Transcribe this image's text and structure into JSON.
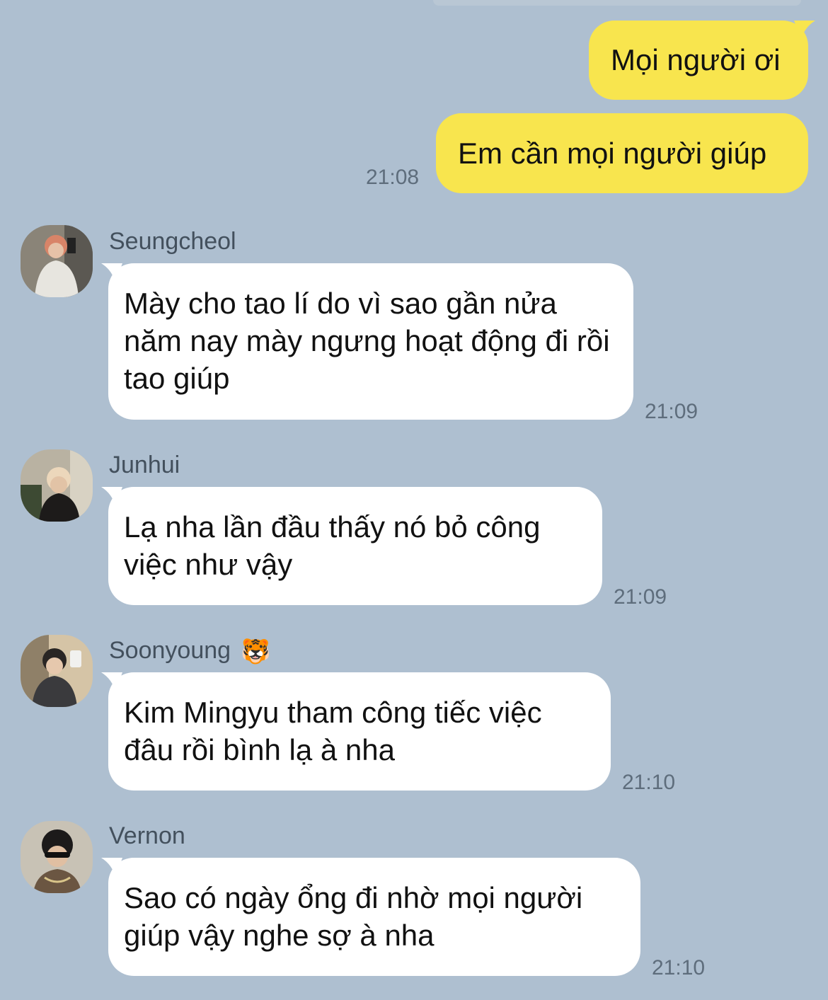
{
  "outgoing": [
    {
      "text": "Mọi người ơi"
    },
    {
      "text": "Em cần mọi người giúp",
      "time": "21:08"
    }
  ],
  "incoming": [
    {
      "name": "Seungcheol",
      "text": "Mày cho tao lí do vì sao gần nửa năm nay mày ngưng hoạt động đi rồi tao giúp",
      "time": "21:09"
    },
    {
      "name": "Junhui",
      "text": "Lạ nha lần đầu thấy nó bỏ công việc như vậy",
      "time": "21:09"
    },
    {
      "name": "Soonyoung",
      "name_emoji": "🐯",
      "text": "Kim Mingyu tham công tiếc việc đâu rồi bình lạ à nha",
      "time": "21:10"
    },
    {
      "name": "Vernon",
      "text": "Sao có ngày ổng đi nhờ mọi người giúp vậy nghe sợ à nha",
      "time": "21:10"
    }
  ],
  "colors": {
    "background": "#aebfd0",
    "outgoing_bubble": "#f8e54e",
    "incoming_bubble": "#ffffff"
  }
}
